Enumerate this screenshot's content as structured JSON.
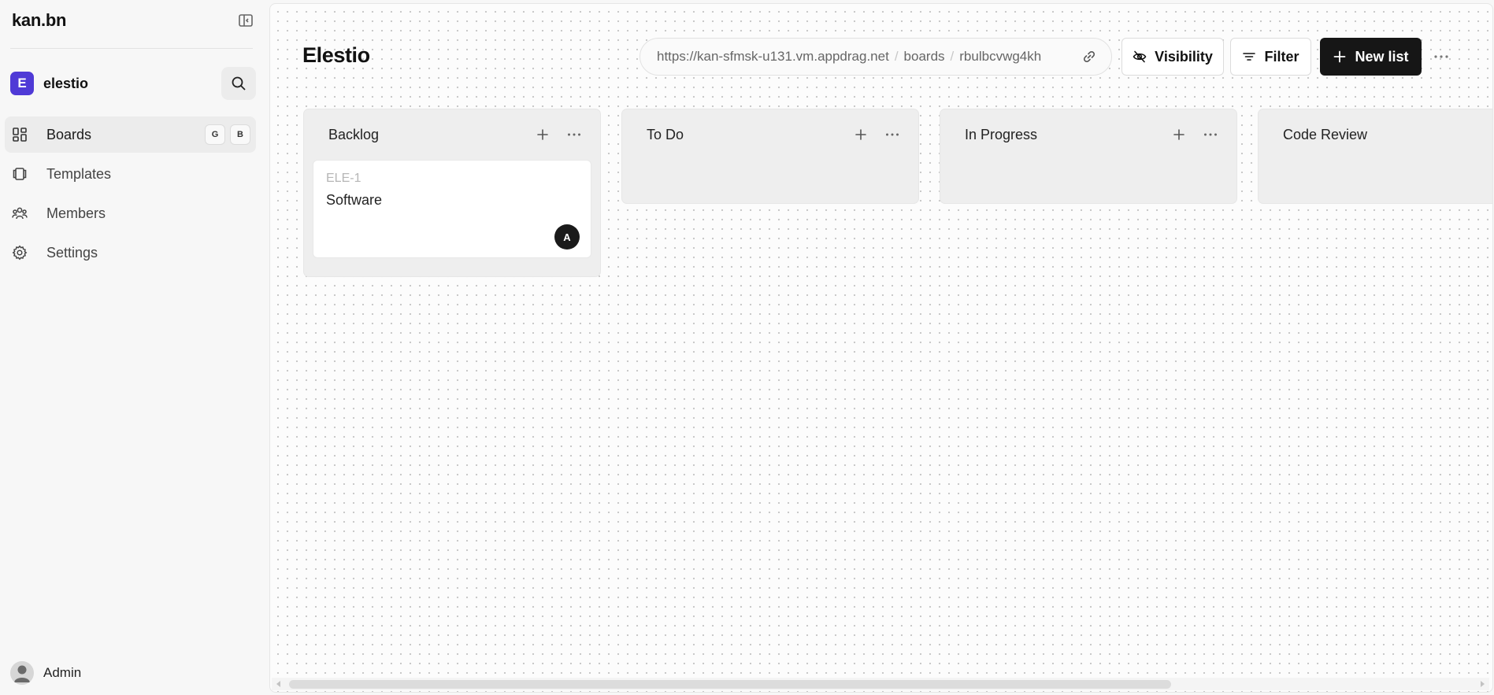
{
  "app": {
    "brand": "kan.bn"
  },
  "workspace": {
    "initial": "E",
    "name": "elestio"
  },
  "nav": {
    "items": [
      {
        "label": "Boards",
        "icon": "grid-icon",
        "active": true,
        "shortcut": [
          "G",
          "B"
        ]
      },
      {
        "label": "Templates",
        "icon": "templates-icon",
        "active": false
      },
      {
        "label": "Members",
        "icon": "members-icon",
        "active": false
      },
      {
        "label": "Settings",
        "icon": "gear-icon",
        "active": false
      }
    ]
  },
  "user": {
    "name": "Admin"
  },
  "board": {
    "title": "Elestio",
    "url": {
      "host": "https://kan-sfmsk-u131.vm.appdrag.net",
      "section": "boards",
      "slug": "rbulbcvwg4kh"
    },
    "buttons": {
      "visibility": "Visibility",
      "filter": "Filter",
      "new_list": "New list"
    }
  },
  "lists": [
    {
      "title": "Backlog",
      "cards": [
        {
          "key": "ELE-1",
          "title": "Software",
          "assignee": "A"
        }
      ]
    },
    {
      "title": "To Do",
      "cards": []
    },
    {
      "title": "In Progress",
      "cards": []
    },
    {
      "title": "Code Review",
      "cards": []
    }
  ],
  "colors": {
    "accent": "#4f3ad6",
    "dark": "#161616",
    "list_bg": "#eeeeee"
  }
}
